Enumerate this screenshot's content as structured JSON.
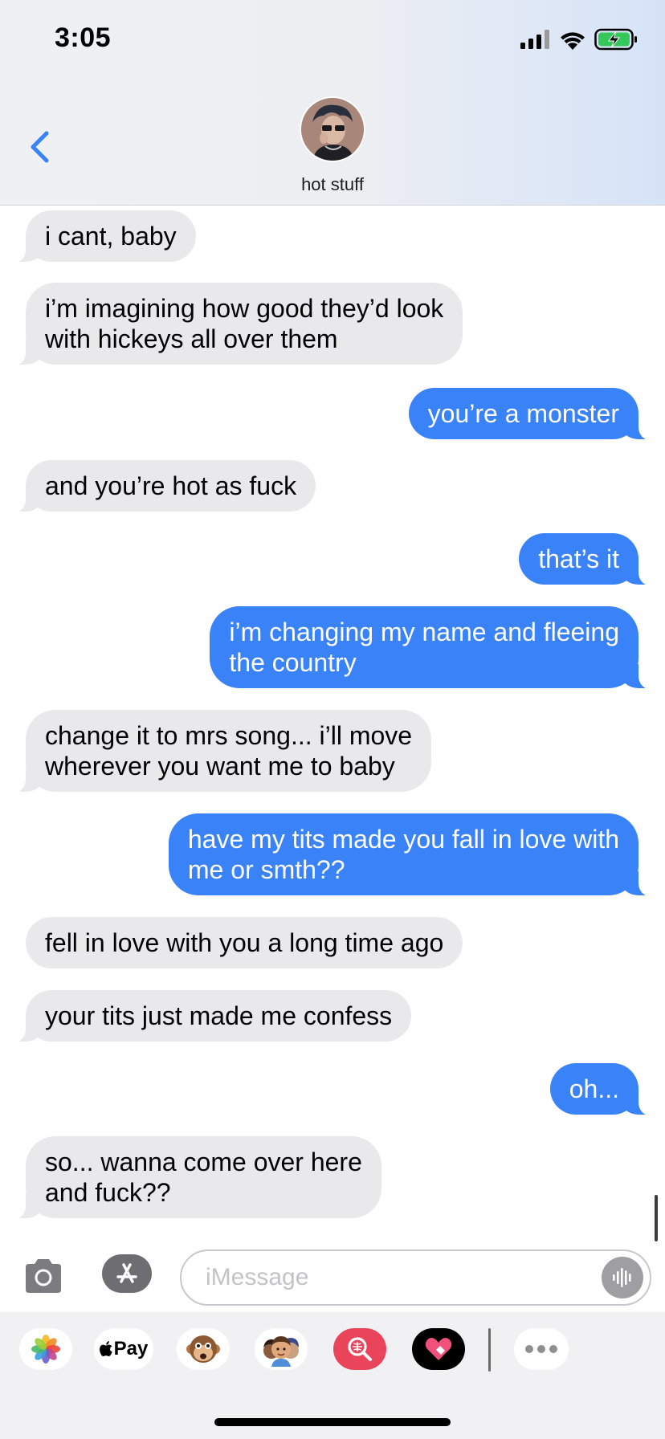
{
  "status_bar": {
    "time": "3:05"
  },
  "header": {
    "contact_name": "hot stuff",
    "avatar": "contact-avatar-photo"
  },
  "messages": [
    {
      "direction": "received",
      "text": "i cant, baby"
    },
    {
      "direction": "received",
      "text": "i’m imagining how good they’d look\nwith hickeys all over them"
    },
    {
      "direction": "sent",
      "text": "you’re a monster"
    },
    {
      "direction": "received",
      "text": "and you’re hot as fuck"
    },
    {
      "direction": "sent",
      "text": "that’s it"
    },
    {
      "direction": "sent",
      "text": "i’m changing my name and fleeing\nthe country"
    },
    {
      "direction": "received",
      "text": "change it to mrs song... i’ll move\nwherever you want me to baby"
    },
    {
      "direction": "sent",
      "text": "have my tits made you fall in love with\nme or smth??"
    },
    {
      "direction": "received",
      "text": "fell in love with you a long time ago"
    },
    {
      "direction": "received",
      "text": "your tits just made me confess"
    },
    {
      "direction": "sent",
      "text": "oh..."
    },
    {
      "direction": "received",
      "text": "so... wanna come over here\nand fuck??"
    }
  ],
  "compose": {
    "placeholder": "iMessage",
    "value": ""
  },
  "app_drawer": {
    "apple_pay_label": "Pay",
    "apps": [
      "photos-icon",
      "apple-pay-icon",
      "animoji-icon",
      "memoji-icon",
      "images-search-icon",
      "digital-touch-icon",
      "more-icon"
    ]
  },
  "colors": {
    "sent_bubble": "#3a82f7",
    "received_bubble": "#e9e9eb",
    "accent": "#3a82f7"
  }
}
